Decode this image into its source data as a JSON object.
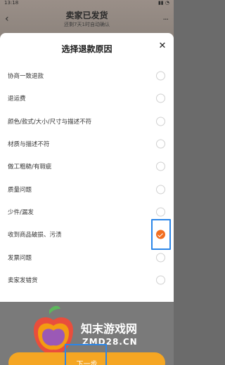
{
  "status_bar": {
    "time": "13:18"
  },
  "header": {
    "title": "卖家已发货",
    "subtitle": "还剩7天1时自动确认"
  },
  "sheet": {
    "title": "选择退款原因",
    "reasons": [
      {
        "label": "协商一致退款",
        "selected": false
      },
      {
        "label": "退运费",
        "selected": false
      },
      {
        "label": "颜色/款式/大小/尺寸与描述不符",
        "selected": false
      },
      {
        "label": "材质与描述不符",
        "selected": false
      },
      {
        "label": "做工粗糙/有瑕疵",
        "selected": false
      },
      {
        "label": "质量问题",
        "selected": false
      },
      {
        "label": "少件/漏发",
        "selected": false
      },
      {
        "label": "收到商品破损、污渍",
        "selected": true
      },
      {
        "label": "发票问题",
        "selected": false
      },
      {
        "label": "卖家发错货",
        "selected": false
      }
    ],
    "next_label": "下一步"
  },
  "watermark": {
    "brand": "知末游戏网",
    "domain": "ZMD28.CN"
  },
  "colors": {
    "accent": "#f26f21",
    "button": "#f5a623",
    "highlight": "#2b86e8"
  }
}
